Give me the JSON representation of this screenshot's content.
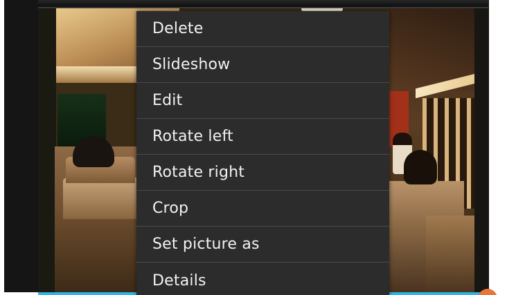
{
  "menu": {
    "items": [
      {
        "label": "Delete"
      },
      {
        "label": "Slideshow"
      },
      {
        "label": "Edit"
      },
      {
        "label": "Rotate left"
      },
      {
        "label": "Rotate right"
      },
      {
        "label": "Crop"
      },
      {
        "label": "Set picture as"
      },
      {
        "label": "Details"
      }
    ]
  },
  "colors": {
    "menu_background": "#2c2c2c",
    "menu_text": "#f2f2f2",
    "menu_divider": "#4a4a4a",
    "accent_line": "#31b6e7"
  }
}
